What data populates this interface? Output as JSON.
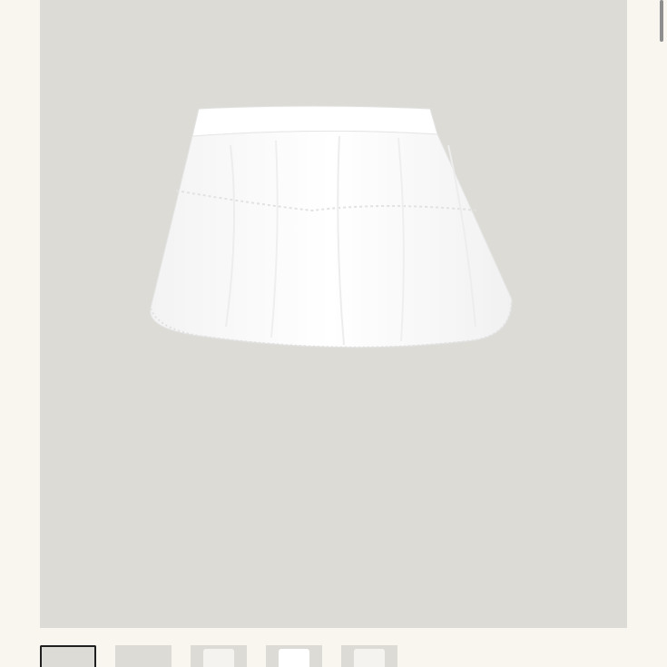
{
  "product": {
    "image_label": "white-mini-skirt-image",
    "background_color": "#dcdbd6",
    "skirt_color": "#ffffff"
  },
  "gallery": {
    "active_index": 0,
    "thumbnails": [
      {
        "name": "thumbnail-1",
        "style": "plain"
      },
      {
        "name": "thumbnail-2",
        "style": "plain"
      },
      {
        "name": "thumbnail-3",
        "style": "light"
      },
      {
        "name": "thumbnail-4",
        "style": "skirt"
      },
      {
        "name": "thumbnail-5",
        "style": "light"
      }
    ]
  },
  "colors": {
    "page_background": "#f9f6ef",
    "active_border": "#1f1f1f"
  }
}
